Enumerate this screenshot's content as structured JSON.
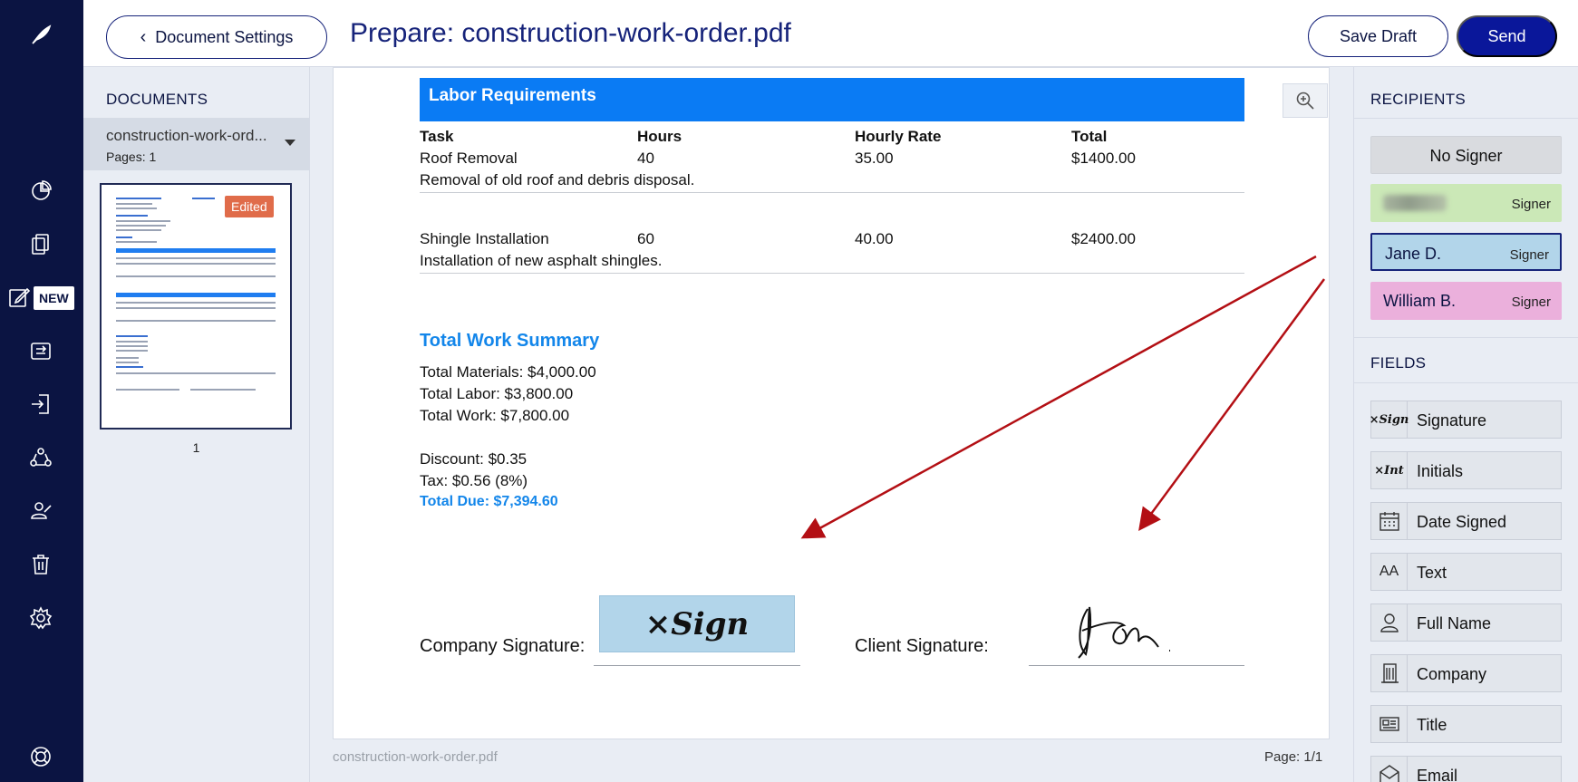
{
  "header": {
    "back_label": "Document Settings",
    "title": "Prepare: construction-work-order.pdf",
    "save_draft_label": "Save Draft",
    "send_label": "Send"
  },
  "nav": {
    "new_badge": "NEW",
    "icons": [
      "feather-logo-icon",
      "pie-chart-icon",
      "documents-icon",
      "edit-icon",
      "templates-icon",
      "import-icon",
      "team-icon",
      "signer-icon",
      "trash-icon",
      "settings-icon",
      "help-icon"
    ]
  },
  "documents": {
    "heading": "DOCUMENTS",
    "items": [
      {
        "name": "construction-work-ord...",
        "pages": "Pages: 1"
      }
    ],
    "thumbnail_badge": "Edited",
    "thumbnail_page_number": "1"
  },
  "document": {
    "section_title": "Labor Requirements",
    "columns": [
      "Task",
      "Hours",
      "Hourly Rate",
      "Total"
    ],
    "rows": [
      {
        "task": "Roof Removal",
        "hours": "40",
        "rate": "35.00",
        "total": "$1400.00",
        "description": "Removal of old roof and debris disposal."
      },
      {
        "task": "Shingle Installation",
        "hours": "60",
        "rate": "40.00",
        "total": "$2400.00",
        "description": "Installation of new asphalt shingles."
      }
    ],
    "summary": {
      "title": "Total Work Summary",
      "materials": "Total Materials: $4,000.00",
      "labor": "Total Labor: $3,800.00",
      "work": "Total Work: $7,800.00",
      "discount": "Discount: $0.35",
      "tax": "Tax: $0.56 (8%)",
      "total_due": "Total Due: $7,394.60"
    },
    "company_signature_label": "Company Signature:",
    "client_signature_label": "Client Signature:",
    "sign_field_text": "×Sign",
    "filename_footer": "construction-work-order.pdf",
    "page_indicator": "Page: 1/1"
  },
  "recipients": {
    "heading": "RECIPIENTS",
    "items": [
      {
        "name": "No Signer",
        "role": ""
      },
      {
        "name": "",
        "role": "Signer",
        "color": "#cbe8b7"
      },
      {
        "name": "Jane D.",
        "role": "Signer",
        "color": "#b2d5ea"
      },
      {
        "name": "William B.",
        "role": "Signer",
        "color": "#ebb0dc"
      }
    ]
  },
  "fields": {
    "heading": "FIELDS",
    "items": [
      {
        "label": "Signature",
        "icon": "signature-icon",
        "icon_text": "×Sign"
      },
      {
        "label": "Initials",
        "icon": "initials-icon",
        "icon_text": "×Int"
      },
      {
        "label": "Date Signed",
        "icon": "calendar-icon"
      },
      {
        "label": "Text",
        "icon": "text-icon",
        "icon_text": "AA"
      },
      {
        "label": "Full Name",
        "icon": "person-icon"
      },
      {
        "label": "Company",
        "icon": "building-icon"
      },
      {
        "label": "Title",
        "icon": "id-card-icon"
      },
      {
        "label": "Email",
        "icon": "envelope-icon"
      }
    ]
  },
  "colors": {
    "nav_bg": "#0b1442",
    "primary": "#0a179a",
    "section_blue": "#0a7bf4",
    "summary_blue": "#1386ea",
    "annotation_arrow": "#b30f14"
  }
}
